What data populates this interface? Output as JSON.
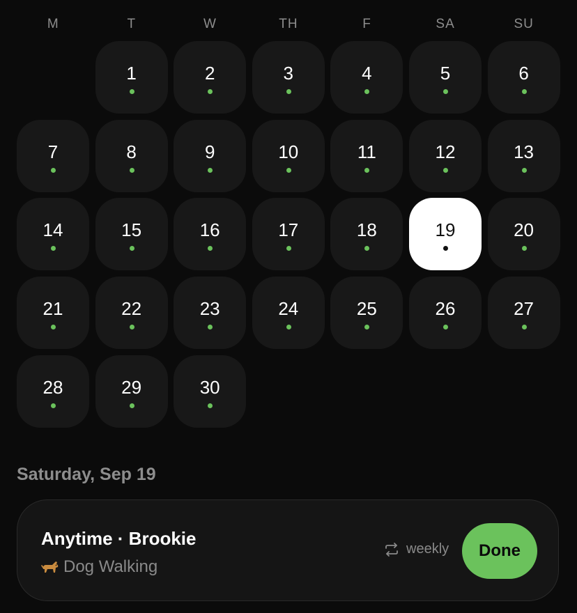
{
  "weekdays": [
    "M",
    "T",
    "W",
    "TH",
    "F",
    "SA",
    "SU"
  ],
  "calendar": {
    "leading_blank_days": 1,
    "days": [
      "1",
      "2",
      "3",
      "4",
      "5",
      "6",
      "7",
      "8",
      "9",
      "10",
      "11",
      "12",
      "13",
      "14",
      "15",
      "16",
      "17",
      "18",
      "19",
      "20",
      "21",
      "22",
      "23",
      "24",
      "25",
      "26",
      "27",
      "28",
      "29",
      "30"
    ],
    "selected_day": "19",
    "day_indicator_color": "#6bc25c"
  },
  "selected_date_label": "Saturday, Sep 19",
  "task": {
    "title": "Anytime · Brookie",
    "category_icon": "dog-icon",
    "category": "Dog Walking",
    "repeat_icon": "repeat-icon",
    "repeat_label": "weekly",
    "done_label": "Done",
    "done_color": "#6bc25c"
  }
}
